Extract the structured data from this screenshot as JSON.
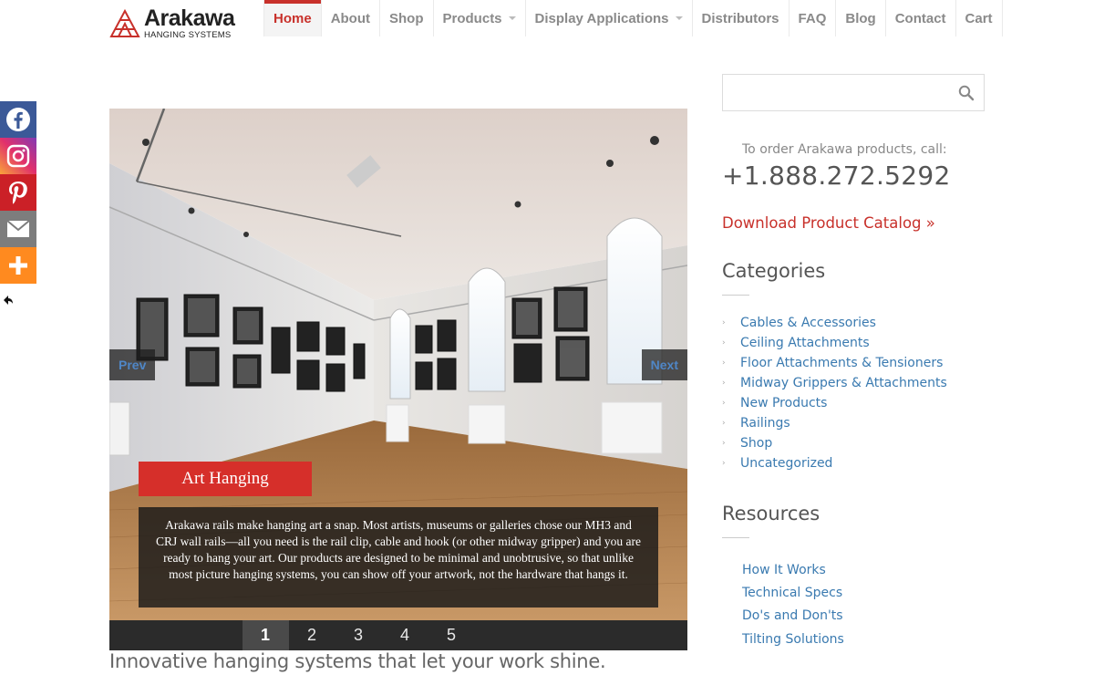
{
  "brand": {
    "name": "Arakawa",
    "subtitle": "HANGING SYSTEMS",
    "color": "#c8312b"
  },
  "nav": {
    "items": [
      {
        "label": "Home",
        "active": true
      },
      {
        "label": "About"
      },
      {
        "label": "Shop"
      },
      {
        "label": "Products",
        "dropdown": true
      },
      {
        "label": "Display Applications",
        "dropdown": true
      },
      {
        "label": "Distributors"
      },
      {
        "label": "FAQ"
      },
      {
        "label": "Blog"
      },
      {
        "label": "Contact"
      },
      {
        "label": "Cart"
      }
    ]
  },
  "social": {
    "items": [
      {
        "name": "facebook-icon",
        "color": "#3b5998"
      },
      {
        "name": "instagram-icon",
        "color": "#c13584"
      },
      {
        "name": "pinterest-icon",
        "color": "#cb2027"
      },
      {
        "name": "email-icon",
        "color": "#7d7d7d"
      },
      {
        "name": "more-icon",
        "color": "#ff8a1f"
      }
    ]
  },
  "slider": {
    "prev_label": "Prev",
    "next_label": "Next",
    "caption_title": "Art Hanging",
    "caption_body": "Arakawa rails make hanging art a snap. Most artists, museums or galleries chose our MH3 and CRJ wall rails—all you need is the rail clip, cable and hook (or other midway gripper) and you are ready to hang your art. Our products are designed to be minimal and unobtrusive, so that unlike most picture hanging systems, you can show off your artwork, not the hardware that hangs it.",
    "pages": [
      "1",
      "2",
      "3",
      "4",
      "5"
    ],
    "active_page": "1"
  },
  "tagline": "Innovative hanging systems that let your work shine.",
  "sidebar": {
    "search": {
      "value": "",
      "placeholder": ""
    },
    "order_label": "To order Arakawa products, call:",
    "phone": "+1.888.272.5292",
    "catalog_link": "Download Product Catalog »",
    "categories_title": "Categories",
    "categories": [
      "Cables & Accessories",
      "Ceiling Attachments",
      "Floor Attachments & Tensioners",
      "Midway Grippers & Attachments",
      "New Products",
      "Railings",
      "Shop",
      "Uncategorized"
    ],
    "resources_title": "Resources",
    "resources": [
      "How It Works",
      "Technical Specs",
      "Do's and Don'ts",
      "Tilting Solutions"
    ]
  }
}
